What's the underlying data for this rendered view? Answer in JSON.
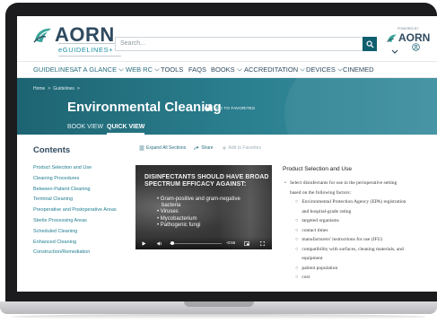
{
  "header": {
    "logo_text": "AORN",
    "logo_sub": "eGUIDELINES+",
    "search_placeholder": "Search...",
    "powered_by": "POWERED BY",
    "small_logo_text": "AORN"
  },
  "nav": {
    "items": [
      {
        "label": "GUIDELINES",
        "dropdown": false
      },
      {
        "label": "AT A GLANCE",
        "dropdown": true
      },
      {
        "label": "WEB RC",
        "dropdown": true
      },
      {
        "label": "TOOLS",
        "dropdown": false
      },
      {
        "label": "FAQS",
        "dropdown": false
      },
      {
        "label": "BOOKS",
        "dropdown": true
      },
      {
        "label": "ACCREDITATION",
        "dropdown": true
      },
      {
        "label": "DEVICES",
        "dropdown": true
      },
      {
        "label": "CINEMED",
        "dropdown": false
      }
    ]
  },
  "banner": {
    "breadcrumb": [
      "Home",
      ">",
      "Guidelines",
      ">"
    ],
    "title": "Environmental Cleaning",
    "favorite_label": "ADD TO FAVORITES",
    "tabs": [
      {
        "label": "BOOK VIEW",
        "active": false
      },
      {
        "label": "QUICK VIEW",
        "active": true
      }
    ]
  },
  "contents": {
    "title": "Contents",
    "items": [
      "Product Selection and Use",
      "Cleaning Procedures",
      "Between-Patient Cleaning",
      "Terminal Cleaning",
      "Preoperative and Postoperative Areas",
      "Sterile Processing Areas",
      "Scheduled Cleaning",
      "Enhanced Cleaning",
      "Construction/Remediation"
    ]
  },
  "tools": {
    "expand": "Expand All Sections",
    "share": "Share",
    "favorite": "Add to Favorites"
  },
  "video": {
    "headline": "DISINFECTANTS SHOULD HAVE BROAD SPECTRUM EFFICACY AGAINST:",
    "bullets": [
      "Gram-positive and gram-negative",
      "bacteria",
      "Viruses",
      "Mycobacterium",
      "Pathogenic fungi"
    ],
    "time": "-0:55",
    "progress": 0.02
  },
  "section": {
    "title": "Product Selection and Use",
    "lead_1": "Select disinfectants for use in the perioperative setting",
    "lead_2": "based on the following factors:",
    "factors": [
      "Environmental Protection Agency (EPA) registration",
      "and hospital-grade rating",
      "targeted organisms",
      "contact times",
      "manufacturers' instructions for use (IFU)",
      "compatibility with surfaces, cleaning materials, and",
      "equipment",
      "patient population",
      "cost"
    ]
  },
  "colors": {
    "brand_teal": "#1e6472",
    "link": "#1f7d91",
    "logo_navy": "#2f4a5f"
  }
}
